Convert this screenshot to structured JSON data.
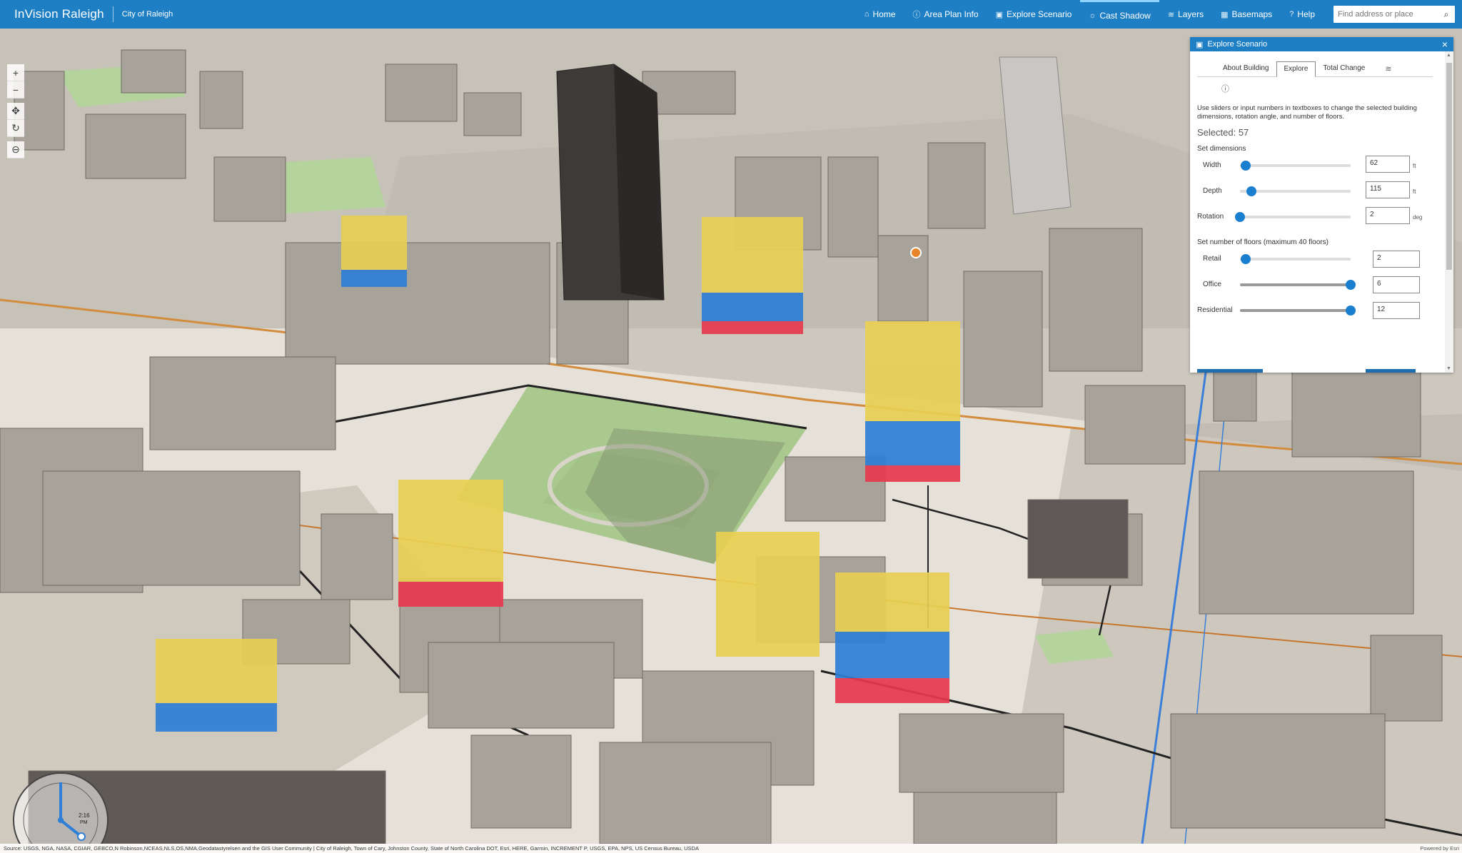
{
  "header": {
    "app_title": "InVision Raleigh",
    "sub_title": "City of Raleigh",
    "nav": [
      {
        "label": "Home",
        "icon": "home-icon",
        "glyph": "⌂"
      },
      {
        "label": "Area Plan Info",
        "icon": "info-icon",
        "glyph": "ⓘ"
      },
      {
        "label": "Explore Scenario",
        "icon": "scenario-icon",
        "glyph": "▣"
      },
      {
        "label": "Cast Shadow",
        "icon": "sun-icon",
        "glyph": "☼"
      },
      {
        "label": "Layers",
        "icon": "layers-icon",
        "glyph": "≋"
      },
      {
        "label": "Basemaps",
        "icon": "basemap-icon",
        "glyph": "▦"
      },
      {
        "label": "Help",
        "icon": "help-icon",
        "glyph": "?"
      }
    ],
    "active_nav": "Cast Shadow",
    "search_placeholder": "Find address or place"
  },
  "map_controls": [
    {
      "name": "zoom-in-button",
      "glyph": "+"
    },
    {
      "name": "zoom-out-button",
      "glyph": "−"
    },
    {
      "name": "pan-button",
      "glyph": "✥"
    },
    {
      "name": "rotate-button",
      "glyph": "↻"
    },
    {
      "name": "compass-button",
      "glyph": "⊖"
    }
  ],
  "compass": {
    "time": "2:16",
    "ampm": "PM"
  },
  "attribution": {
    "text": "Source: USGS, NGA, NASA, CGIAR, GEBCO,N Robinson,NCEAS,NLS,OS,NMA,Geodatastyrelsen and the GIS User Community | City of Raleigh, Town of Cary, Johnston County, State of North Carolina DOT, Esri, HERE, Garmin, INCREMENT P, USGS, EPA, NPS, US Census Bureau, USDA",
    "powered_by": "Powered by Esri"
  },
  "panel": {
    "title": "Explore Scenario",
    "tabs": [
      "About Building",
      "Explore",
      "Total Change"
    ],
    "active_tab": "Explore",
    "instructions": "Use sliders or input numbers in textboxes to change the selected building dimensions, rotation angle, and number of floors.",
    "selected": "Selected: 57",
    "dimensions_label": "Set dimensions",
    "dimensions": [
      {
        "label": "Width",
        "value": "62",
        "unit": "ft",
        "fraction": 0.05
      },
      {
        "label": "Depth",
        "value": "115",
        "unit": "ft",
        "fraction": 0.1
      },
      {
        "label": "Rotation",
        "value": "2",
        "unit": "deg",
        "fraction": 0.0
      }
    ],
    "floors_label": "Set number of floors (maximum 40 floors)",
    "floors": [
      {
        "label": "Retail",
        "value": "2",
        "fraction": 0.05
      },
      {
        "label": "Office",
        "value": "6",
        "fraction": 1.0
      },
      {
        "label": "Residential",
        "value": "12",
        "fraction": 1.0
      }
    ]
  }
}
